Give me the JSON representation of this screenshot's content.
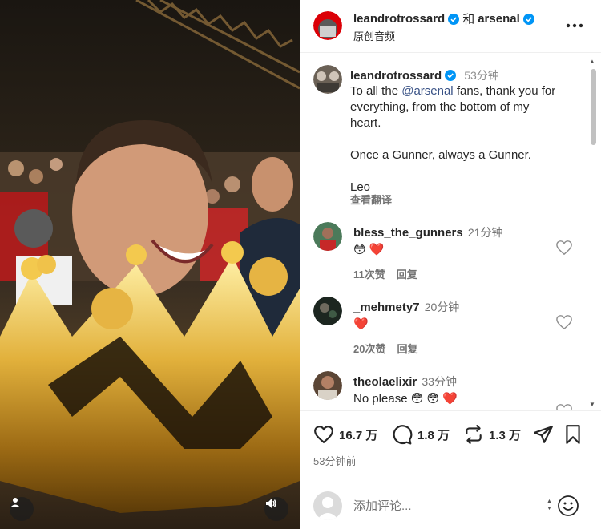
{
  "header": {
    "author": "leandrotrossard",
    "connector": "和",
    "collaborator": "arsenal",
    "audio_label": "原创音频",
    "more_icon": "more-horizontal-icon"
  },
  "caption": {
    "username": "leandrotrossard",
    "time": "53分钟",
    "text_before_mention": "To all the ",
    "mention": "@arsenal",
    "text_after_mention": " fans, thank you for everything, from the bottom of my heart.\n\nOnce a Gunner, always a Gunner.\n\nLeo",
    "translate_label": "查看翻译"
  },
  "comments": [
    {
      "username": "bless_the_gunners",
      "time": "21分钟",
      "text": "😳 ❤️",
      "likes_label": "11次赞",
      "reply_label": "回复"
    },
    {
      "username": "_mehmety7",
      "time": "20分钟",
      "text": "❤️",
      "likes_label": "20次赞",
      "reply_label": "回复"
    },
    {
      "username": "theolaelixir",
      "time": "33分钟",
      "text": "No please 😳 😳 ❤️",
      "likes_label": "",
      "reply_label": ""
    }
  ],
  "actions": {
    "likes": "16.7 万",
    "comments": "1.8 万",
    "reposts": "1.3 万",
    "posted_time": "53分钟前"
  },
  "add_comment": {
    "placeholder": "添加评论..."
  },
  "colors": {
    "verified_blue": "#0095f6",
    "mention_blue": "#385185",
    "secondary_text": "#737373",
    "arsenal_red": "#db0007"
  }
}
